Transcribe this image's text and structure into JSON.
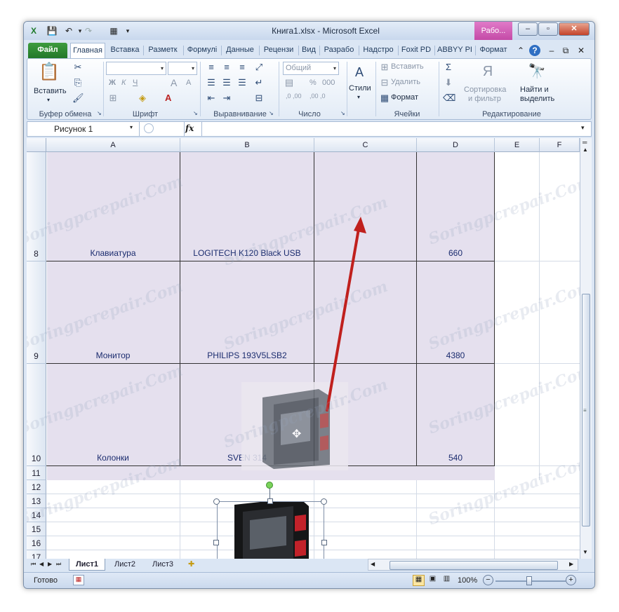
{
  "window": {
    "title": "Книга1.xlsx  -  Microsoft Excel",
    "context_tab": "Рабо..."
  },
  "tabs": [
    "Файл",
    "Главная",
    "Вставка",
    "Разметк",
    "Формулі",
    "Данные",
    "Рецензи",
    "Вид",
    "Разрабо",
    "Надстро",
    "Foxit PD",
    "ABBYY PI",
    "Формат"
  ],
  "ribbon": {
    "clipboard": {
      "paste": "Вставить",
      "label": "Буфер обмена"
    },
    "font": {
      "label": "Шрифт",
      "bold": "Ж",
      "italic": "К",
      "underline": "Ч",
      "grow": "A",
      "shrink": "A"
    },
    "alignment": {
      "label": "Выравнивание"
    },
    "number": {
      "format": "Общий",
      "label": "Число",
      "percent": "%",
      "thousands": "000"
    },
    "styles": {
      "label": "Стили"
    },
    "cells": {
      "insert": "Вставить",
      "delete": "Удалить",
      "format": "Формат",
      "label": "Ячейки"
    },
    "editing": {
      "sort_line1": "Сортировка",
      "sort_line2": "и фильтр",
      "find_line1": "Найти и",
      "find_line2": "выделить",
      "label": "Редактирование"
    }
  },
  "formula_bar": {
    "name_box": "Рисунок 1",
    "fx": "fx",
    "value": ""
  },
  "columns": [
    "A",
    "B",
    "C",
    "D",
    "E",
    "F"
  ],
  "rows": [
    {
      "num": "8",
      "a": "Клавиатура",
      "b": "LOGITECH K120 Black USB",
      "d": "660"
    },
    {
      "num": "9",
      "a": "Монитор",
      "b": "PHILIPS 193V5LSB2",
      "d": "4380"
    },
    {
      "num": "10",
      "a": "Колонки",
      "b": "SVEN 314",
      "d": "540"
    }
  ],
  "empty_rows": [
    "11",
    "12",
    "13",
    "14",
    "15",
    "16",
    "17"
  ],
  "watermark": "Soringpcrepair.Com",
  "sheets": [
    "Лист1",
    "Лист2",
    "Лист3"
  ],
  "status": {
    "ready": "Готово",
    "zoom": "100%"
  },
  "accent": {
    "file_tab": "#2a7f2f",
    "context_tab": "#c84fae",
    "arrow": "#c0201d",
    "table_fill": "#e5e0ee"
  }
}
